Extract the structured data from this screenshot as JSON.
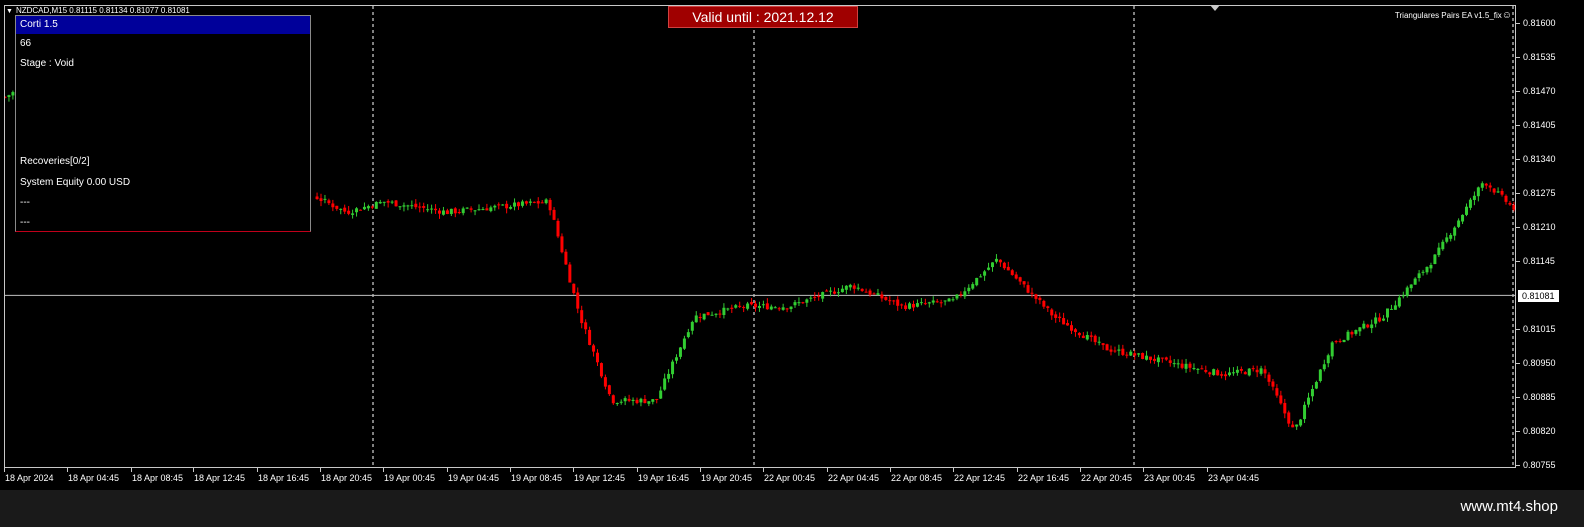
{
  "symbol_header": "NZDCAD,M15  0.81115 0.81134 0.81077 0.81081",
  "panel": {
    "title": "Corti 1.5",
    "line1": "66",
    "line2": "Stage : Void",
    "line3": "Recoveries[0/2]",
    "line4": "System Equity 0.00 USD",
    "line5": "---",
    "line6": "---"
  },
  "valid_badge": "Valid until : 2021.12.12",
  "ea_label": "Triangulares Pairs EA  v1.5_fix",
  "ea_icon": "smiley-icon",
  "current_price": "0.81081",
  "price_axis": [
    "0.81600",
    "0.81535",
    "0.81470",
    "0.81405",
    "0.81340",
    "0.81275",
    "0.81210",
    "0.81145",
    "0.81015",
    "0.80950",
    "0.80885",
    "0.80820",
    "0.80755"
  ],
  "time_axis": [
    "18 Apr 2024",
    "18 Apr 04:45",
    "18 Apr 08:45",
    "18 Apr 12:45",
    "18 Apr 16:45",
    "18 Apr 20:45",
    "19 Apr 00:45",
    "19 Apr 04:45",
    "19 Apr 08:45",
    "19 Apr 12:45",
    "19 Apr 16:45",
    "19 Apr 20:45",
    "22 Apr 00:45",
    "22 Apr 04:45",
    "22 Apr 08:45",
    "22 Apr 12:45",
    "22 Apr 16:45",
    "22 Apr 20:45",
    "23 Apr 00:45",
    "23 Apr 04:45"
  ],
  "footer": "www.mt4.shop",
  "colors": {
    "bull": "#32cd32",
    "bear": "#ff0000",
    "background": "#000000",
    "grid_separator": "#ffffff"
  },
  "chart_data": {
    "type": "candlestick",
    "symbol": "NZDCAD",
    "timeframe": "M15",
    "ylim": [
      0.80755,
      0.8163
    ],
    "last_price": 0.81081,
    "close_path": [
      [
        0.0,
        0.8146
      ],
      [
        0.3,
        0.8148
      ],
      [
        0.6,
        0.8142
      ],
      [
        1.0,
        0.814
      ],
      [
        3.6,
        0.8128
      ],
      [
        4.4,
        0.813
      ],
      [
        5.4,
        0.8124
      ],
      [
        6.0,
        0.8126
      ],
      [
        7.0,
        0.8124
      ],
      [
        7.8,
        0.8125
      ],
      [
        8.6,
        0.8126
      ],
      [
        9.1,
        0.8104
      ],
      [
        9.6,
        0.8088
      ],
      [
        10.3,
        0.8088
      ],
      [
        10.9,
        0.8104
      ],
      [
        11.7,
        0.8106
      ],
      [
        12.4,
        0.8106
      ],
      [
        13.4,
        0.811
      ],
      [
        14.2,
        0.8106
      ],
      [
        15.0,
        0.8107
      ],
      [
        15.7,
        0.8115
      ],
      [
        16.6,
        0.8104
      ],
      [
        17.4,
        0.8098
      ],
      [
        18.5,
        0.8095
      ],
      [
        19.3,
        0.8093
      ],
      [
        19.9,
        0.8094
      ],
      [
        20.4,
        0.8082
      ],
      [
        21.0,
        0.8099
      ],
      [
        21.8,
        0.8104
      ],
      [
        22.6,
        0.8115
      ],
      [
        23.4,
        0.813
      ],
      [
        24.2,
        0.8121
      ],
      [
        25.0,
        0.8116
      ],
      [
        25.9,
        0.8112
      ],
      [
        26.6,
        0.811
      ],
      [
        27.3,
        0.8108
      ],
      [
        28.0,
        0.8104
      ],
      [
        28.8,
        0.8106
      ],
      [
        29.8,
        0.81
      ],
      [
        30.6,
        0.81
      ],
      [
        31.4,
        0.8106
      ],
      [
        32.2,
        0.8108
      ],
      [
        33.0,
        0.8108
      ],
      [
        33.8,
        0.8106
      ],
      [
        34.5,
        0.8106
      ],
      [
        35.2,
        0.8107
      ],
      [
        35.8,
        0.8104
      ],
      [
        36.4,
        0.811
      ],
      [
        37.0,
        0.8106
      ],
      [
        37.6,
        0.8113
      ],
      [
        38.0,
        0.8109
      ],
      [
        38.2,
        0.81081
      ]
    ]
  }
}
